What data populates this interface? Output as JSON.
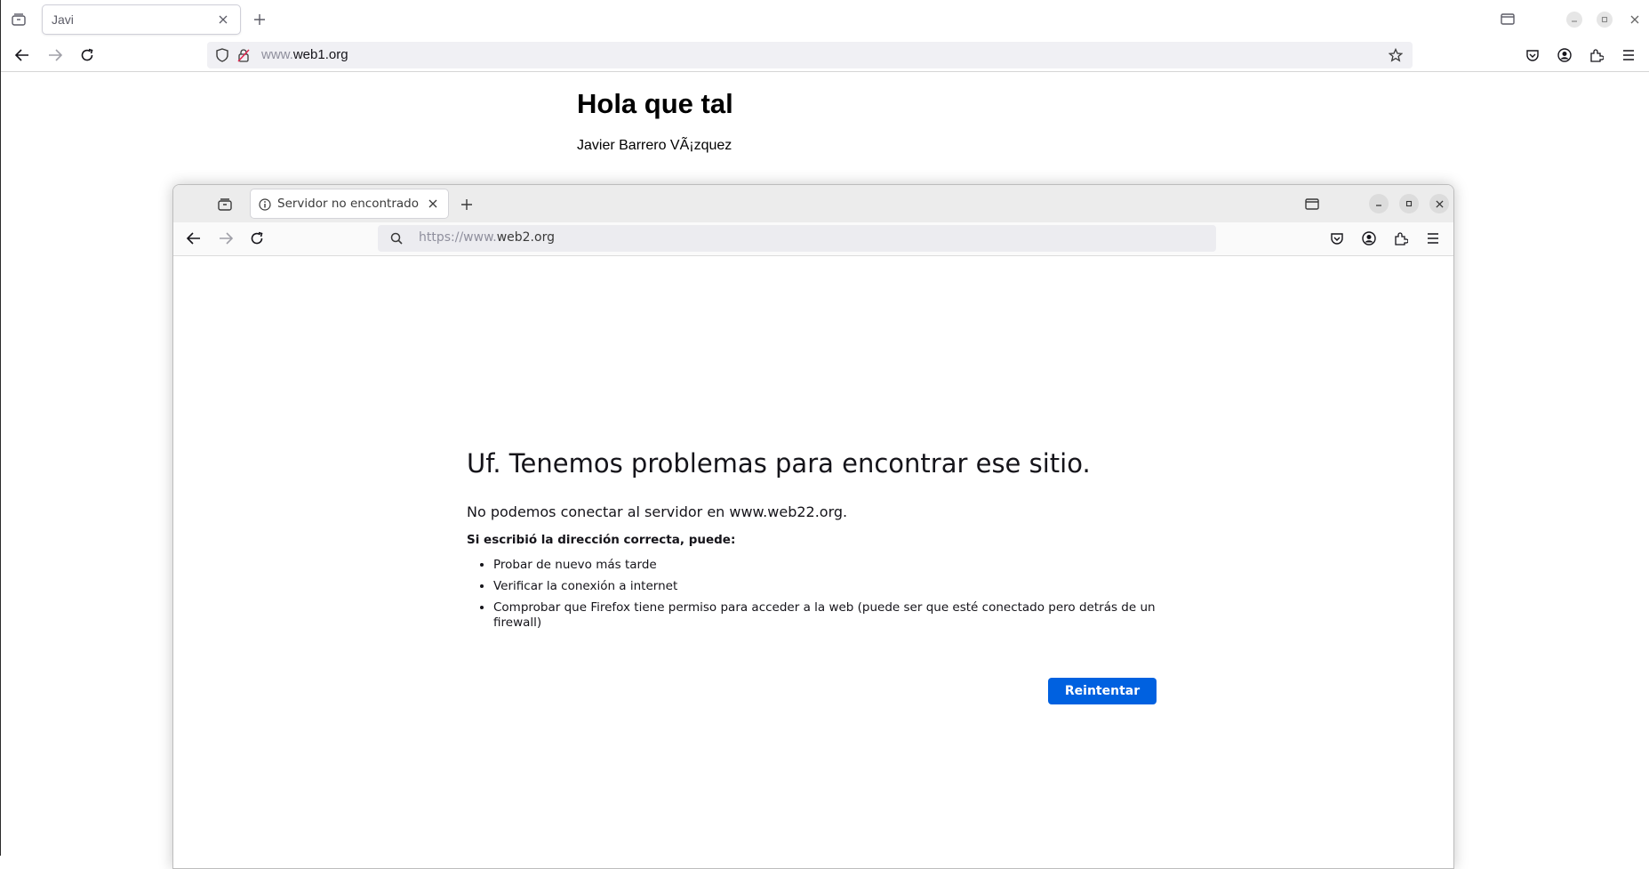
{
  "outer_browser": {
    "tab": {
      "title": "Javi"
    },
    "url": {
      "prefix": "www.",
      "domain": "web1.org"
    }
  },
  "page": {
    "heading": "Hola que tal",
    "author": "Javier Barrero VÃ¡zquez"
  },
  "inner_browser": {
    "tab": {
      "title": "Servidor no encontrado"
    },
    "url": {
      "prefix": "https://www.",
      "domain": "web2.org"
    },
    "error": {
      "title": "Uf. Tenemos problemas para encontrar ese sitio.",
      "description": "No podemos conectar al servidor en www.web22.org.",
      "subheading": "Si escribió la dirección correcta, puede:",
      "suggestions": [
        "Probar de nuevo más tarde",
        "Verificar la conexión a internet",
        "Comprobar que Firefox tiene permiso para acceder a la web (puede ser que esté conectado pero detrás de un firewall)"
      ],
      "retry_label": "Reintentar"
    }
  },
  "colors": {
    "accent": "#0061e0",
    "background": "#ffffff",
    "text": "#15141a"
  },
  "icons": [
    "tab-list-icon",
    "close-icon",
    "plus-icon",
    "back-icon",
    "forward-icon",
    "reload-icon",
    "shield-icon",
    "insecure-lock-icon",
    "star-icon",
    "pocket-icon",
    "account-icon",
    "extensions-icon",
    "menu-icon",
    "info-icon",
    "search-icon",
    "browser-tab-icon"
  ]
}
